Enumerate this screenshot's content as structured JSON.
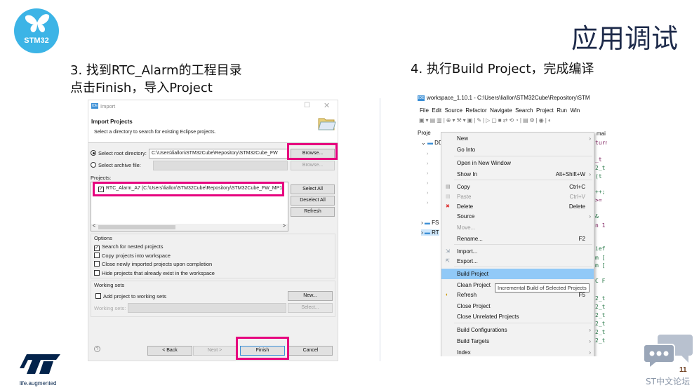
{
  "slide": {
    "logo_text": "STM32",
    "title": "应用调试",
    "page_number": "11",
    "forum_label": "ST中文论坛",
    "st_tagline": "life.augmented",
    "accent": "#e6007e",
    "brand_blue": "#3cb4e6"
  },
  "step3": {
    "line1": "3. 找到RTC_Alarm的工程目录",
    "line2": "点击Finish，导入Project"
  },
  "step4": {
    "heading": "4. 执行Build Project，完成编译"
  },
  "dialog": {
    "app_badge": "IDE",
    "window_title": "Import",
    "heading": "Import Projects",
    "description": "Select a directory to search for existing Eclipse projects.",
    "root_dir_label": "Select root directory:",
    "root_dir_value": "C:\\Users\\liallon\\STM32Cube\\Repository\\STM32Cube_FW",
    "archive_label": "Select archive file:",
    "browse": "Browse...",
    "projects_label": "Projects:",
    "project_item": "RTC_Alarm_A7 (C:\\Users\\liallon\\STM32Cube\\Repository\\STM32Cube_FW_MP1",
    "select_all": "Select All",
    "deselect_all": "Deselect All",
    "refresh": "Refresh",
    "options_label": "Options",
    "options": [
      {
        "label": "Search for nested projects",
        "checked": true
      },
      {
        "label": "Copy projects into workspace",
        "checked": false
      },
      {
        "label": "Close newly imported projects upon completion",
        "checked": false
      },
      {
        "label": "Hide projects that already exist in the workspace",
        "checked": false
      }
    ],
    "working_sets_label": "Working sets",
    "add_to_ws": "Add project to working sets",
    "new": "New...",
    "ws_field_label": "Working sets:",
    "select": "Select...",
    "help": "?",
    "back": "< Back",
    "next": "Next >",
    "finish": "Finish",
    "cancel": "Cancel"
  },
  "ide": {
    "window_title": "workspace_1.10.1 - C:\\Users\\liallon\\STM32Cube\\Repository\\STM",
    "menus": [
      "File",
      "Edit",
      "Source",
      "Refactor",
      "Navigate",
      "Search",
      "Project",
      "Run",
      "Win"
    ],
    "explorer_label": "Proje",
    "tree": [
      "DD",
      "FS",
      "RT"
    ],
    "editor_tab": "mai",
    "context_menu": [
      {
        "label": "New",
        "arrow": true
      },
      {
        "label": "Go Into"
      },
      {
        "label": "Open in New Window"
      },
      {
        "label": "Show In",
        "shortcut": "Alt+Shift+W",
        "arrow": true
      },
      {
        "label": "Copy",
        "shortcut": "Ctrl+C",
        "icon": "copy-icon"
      },
      {
        "label": "Paste",
        "shortcut": "Ctrl+V",
        "disabled": true,
        "icon": "paste-icon"
      },
      {
        "label": "Delete",
        "shortcut": "Delete",
        "icon": "delete-icon"
      },
      {
        "label": "Source",
        "arrow": true
      },
      {
        "label": "Move...",
        "disabled": true
      },
      {
        "label": "Rename...",
        "shortcut": "F2"
      },
      {
        "label": "Import...",
        "icon": "import-icon"
      },
      {
        "label": "Export...",
        "icon": "export-icon"
      },
      {
        "label": "Build Project",
        "highlighted": true
      },
      {
        "label": "Clean Project"
      },
      {
        "label": "Refresh",
        "shortcut": "F5",
        "icon": "refresh-icon"
      },
      {
        "label": "Close Project"
      },
      {
        "label": "Close Unrelated Projects"
      },
      {
        "label": "Build Configurations",
        "arrow": true
      },
      {
        "label": "Build Targets",
        "arrow": true
      },
      {
        "label": "Index",
        "arrow": true
      }
    ],
    "tooltip": "Incremental Build of Selected Projects",
    "code_fragments": [
      "turn",
      "_t",
      "2_t",
      "(t",
      "++;",
      ">=",
      "&",
      "n 1",
      "ief",
      "m [",
      "m [",
      "C F",
      "2_t",
      "2_t",
      "2_t",
      "2_t",
      "2_t",
      "2_t"
    ]
  }
}
